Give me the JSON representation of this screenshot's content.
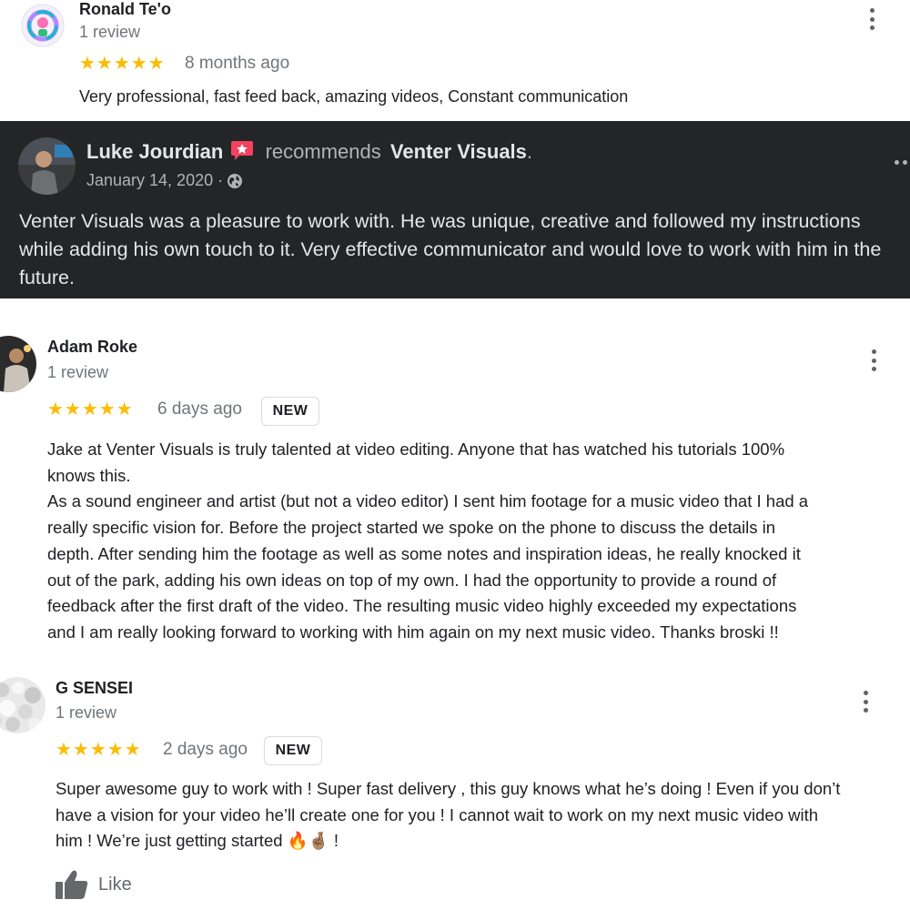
{
  "reviews": [
    {
      "name": "Ronald Te'o",
      "count": "1 review",
      "stars": "★★★★★",
      "age": "8 months ago",
      "text": "Very professional, fast feed back, amazing videos, Constant communication"
    },
    {
      "name": "Adam Roke",
      "count": "1 review",
      "stars": "★★★★★",
      "age": "6 days ago",
      "badge": "NEW",
      "text": "Jake at Venter Visuals is truly talented at video editing. Anyone that has watched his tutorials 100%\nknows this.\nAs a sound engineer and artist (but not a video editor) I sent him footage for a music video that I had a\nreally specific vision for. Before the project started we spoke on the phone to discuss the details in\ndepth. After sending him the footage as well as some notes and inspiration ideas, he really knocked it\nout of the park, adding his own ideas on top of my own. I had the opportunity to provide a round of\nfeedback after the first draft of the video. The resulting music video highly exceeded my expectations\nand I am really looking forward to working with him again on my next music video. Thanks broski !!"
    },
    {
      "name": "G SENSEI",
      "count": "1 review",
      "stars": "★★★★★",
      "age": "2 days ago",
      "badge": "NEW",
      "text": "Super awesome guy to work with ! Super fast delivery , this guy knows what he’s doing ! Even if you don’t\nhave a vision for your video he’ll create one for you ! I cannot wait to work on my next music video with\nhim ! We’re just getting started 🔥🤞🏽 !"
    }
  ],
  "facebook": {
    "name": "Luke Jourdian",
    "recommends": "recommends",
    "page": "Venter Visuals",
    "period": ".",
    "date": "January 14, 2020 · ",
    "text": "Venter Visuals was a pleasure to work with. He was unique, creative and followed my instructions while adding his own touch to it. Very effective communicator and would love to work with him in the future."
  },
  "like_label": "Like",
  "colors": {
    "star": "#fbbc04",
    "fb_bg": "#242526",
    "fb_badge": "#f3425f"
  },
  "icons": [
    "avatar",
    "recommend-icon",
    "globe-icon",
    "more-options-icon",
    "thumbs-up-icon"
  ]
}
